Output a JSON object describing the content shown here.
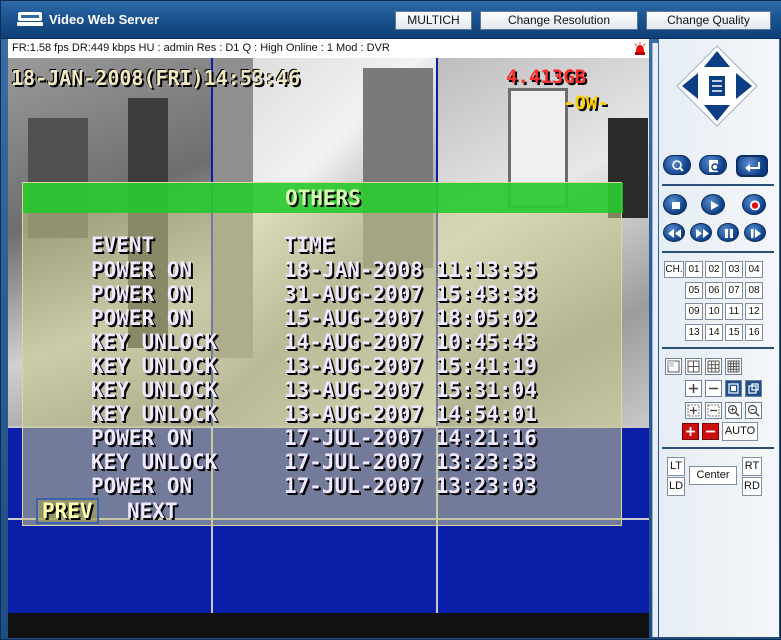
{
  "window": {
    "title": "Video Web Server",
    "buttons": {
      "multich": "MULTICH",
      "change_resolution": "Change Resolution",
      "change_quality": "Change Quality"
    }
  },
  "status": {
    "text": "FR:1.58 fps  DR:449 kbps  HU : admin  Res : D1  Q : High  Online : 1 Mod : DVR"
  },
  "osd": {
    "datetime": "18-JAN-2008(FRI)14:53:46",
    "hdd": "4.413GB",
    "mode": "-OW-"
  },
  "menu": {
    "title": "OTHERS",
    "headers": {
      "event": "EVENT",
      "time": "TIME"
    },
    "rows": [
      {
        "event": "POWER ON",
        "time": "18-JAN-2008 11:13:35"
      },
      {
        "event": "POWER ON",
        "time": "31-AUG-2007 15:43:38"
      },
      {
        "event": "POWER ON",
        "time": "15-AUG-2007 18:05:02"
      },
      {
        "event": "KEY UNLOCK",
        "time": "14-AUG-2007 10:45:43"
      },
      {
        "event": "KEY UNLOCK",
        "time": "13-AUG-2007 15:41:19"
      },
      {
        "event": "KEY UNLOCK",
        "time": "13-AUG-2007 15:31:04"
      },
      {
        "event": "KEY UNLOCK",
        "time": "13-AUG-2007 14:54:01"
      },
      {
        "event": "POWER ON",
        "time": "17-JUL-2007 14:21:16"
      },
      {
        "event": "KEY UNLOCK",
        "time": "17-JUL-2007 13:23:33"
      },
      {
        "event": "POWER ON",
        "time": "17-JUL-2007 13:23:03"
      }
    ],
    "prev": "PREV",
    "next": "NEXT"
  },
  "panel": {
    "ch_label": "CH.",
    "channels": [
      "01",
      "02",
      "03",
      "04",
      "05",
      "06",
      "07",
      "08",
      "09",
      "10",
      "11",
      "12",
      "13",
      "14",
      "15",
      "16"
    ],
    "auto": "AUTO",
    "lt": "LT",
    "ld": "LD",
    "center": "Center",
    "rt": "RT",
    "rd": "RD"
  },
  "colors": {
    "video_bg": "#0a1ea8",
    "menu_header": "#1ec828",
    "hdd_text": "#ff3030",
    "accent": "#0c3e86"
  }
}
